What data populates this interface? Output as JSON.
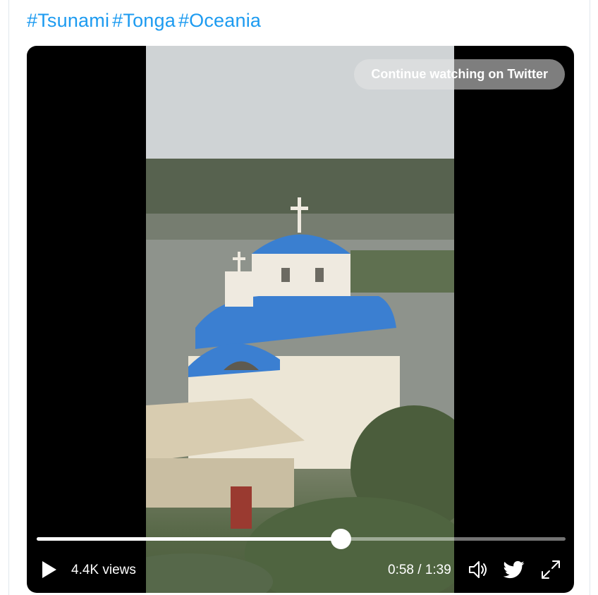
{
  "tweet": {
    "hashtags": [
      "#Tsunami",
      "#Tonga",
      "#Oceania"
    ]
  },
  "video": {
    "overlay_button_label": "Continue watching on Twitter",
    "progress": 0.575,
    "views_label": "4.4K views",
    "time_label": "0:58 / 1:39",
    "icons": {
      "play": "play-icon",
      "volume": "volume-icon",
      "twitter": "twitter-bird-icon",
      "fullscreen": "fullscreen-icon"
    }
  },
  "colors": {
    "hashtag": "#1d9bf0",
    "player_bg": "#000000"
  }
}
